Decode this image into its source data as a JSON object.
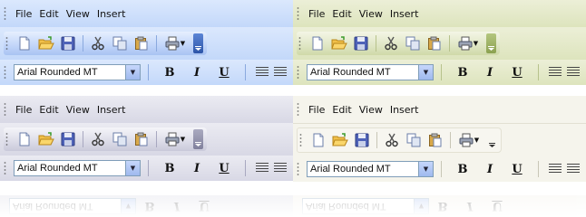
{
  "menu_items": [
    "File",
    "Edit",
    "View",
    "Insert"
  ],
  "font_combo_value": "Arial Rounded MT",
  "format_buttons": {
    "bold": "B",
    "italic": "I",
    "underline": "U"
  },
  "toolbar_icons": [
    "new-document-icon",
    "open-folder-icon",
    "save-disk-icon",
    "cut-scissors-icon",
    "copy-icon",
    "paste-icon",
    "print-icon"
  ],
  "themes": [
    {
      "name": "blue",
      "accent": "#2d55a8"
    },
    {
      "name": "olive",
      "accent": "#8ba150"
    },
    {
      "name": "silver",
      "accent": "#80809c"
    },
    {
      "name": "classic",
      "accent": "#c8c6b6"
    }
  ]
}
